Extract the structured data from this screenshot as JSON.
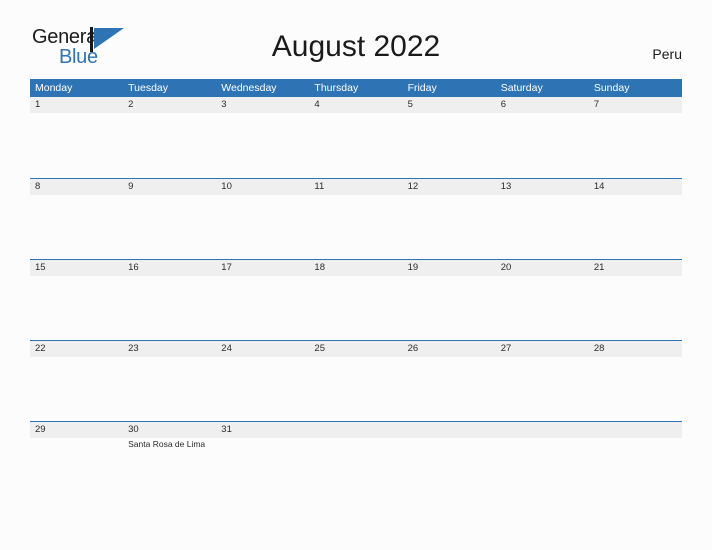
{
  "brand": {
    "name_part1": "General",
    "name_part2": "Blue",
    "logo_icon": "blue-triangle-flag-icon",
    "accent_color": "#2e74b5"
  },
  "header": {
    "title": "August 2022",
    "region": "Peru"
  },
  "colors": {
    "header_blue": "#2e74b5",
    "row_band_gray": "#efefef",
    "page_background": "#fcfcfc",
    "text": "#2b2b2b"
  },
  "calendar": {
    "month": "August",
    "year": "2022",
    "weekday_headers": [
      "Monday",
      "Tuesday",
      "Wednesday",
      "Thursday",
      "Friday",
      "Saturday",
      "Sunday"
    ],
    "weeks": [
      [
        {
          "day": "1",
          "events": []
        },
        {
          "day": "2",
          "events": []
        },
        {
          "day": "3",
          "events": []
        },
        {
          "day": "4",
          "events": []
        },
        {
          "day": "5",
          "events": []
        },
        {
          "day": "6",
          "events": []
        },
        {
          "day": "7",
          "events": []
        }
      ],
      [
        {
          "day": "8",
          "events": []
        },
        {
          "day": "9",
          "events": []
        },
        {
          "day": "10",
          "events": []
        },
        {
          "day": "11",
          "events": []
        },
        {
          "day": "12",
          "events": []
        },
        {
          "day": "13",
          "events": []
        },
        {
          "day": "14",
          "events": []
        }
      ],
      [
        {
          "day": "15",
          "events": []
        },
        {
          "day": "16",
          "events": []
        },
        {
          "day": "17",
          "events": []
        },
        {
          "day": "18",
          "events": []
        },
        {
          "day": "19",
          "events": []
        },
        {
          "day": "20",
          "events": []
        },
        {
          "day": "21",
          "events": []
        }
      ],
      [
        {
          "day": "22",
          "events": []
        },
        {
          "day": "23",
          "events": []
        },
        {
          "day": "24",
          "events": []
        },
        {
          "day": "25",
          "events": []
        },
        {
          "day": "26",
          "events": []
        },
        {
          "day": "27",
          "events": []
        },
        {
          "day": "28",
          "events": []
        }
      ],
      [
        {
          "day": "29",
          "events": []
        },
        {
          "day": "30",
          "events": [
            "Santa Rosa de Lima"
          ]
        },
        {
          "day": "31",
          "events": []
        },
        {
          "day": "",
          "events": []
        },
        {
          "day": "",
          "events": []
        },
        {
          "day": "",
          "events": []
        },
        {
          "day": "",
          "events": []
        }
      ]
    ]
  }
}
